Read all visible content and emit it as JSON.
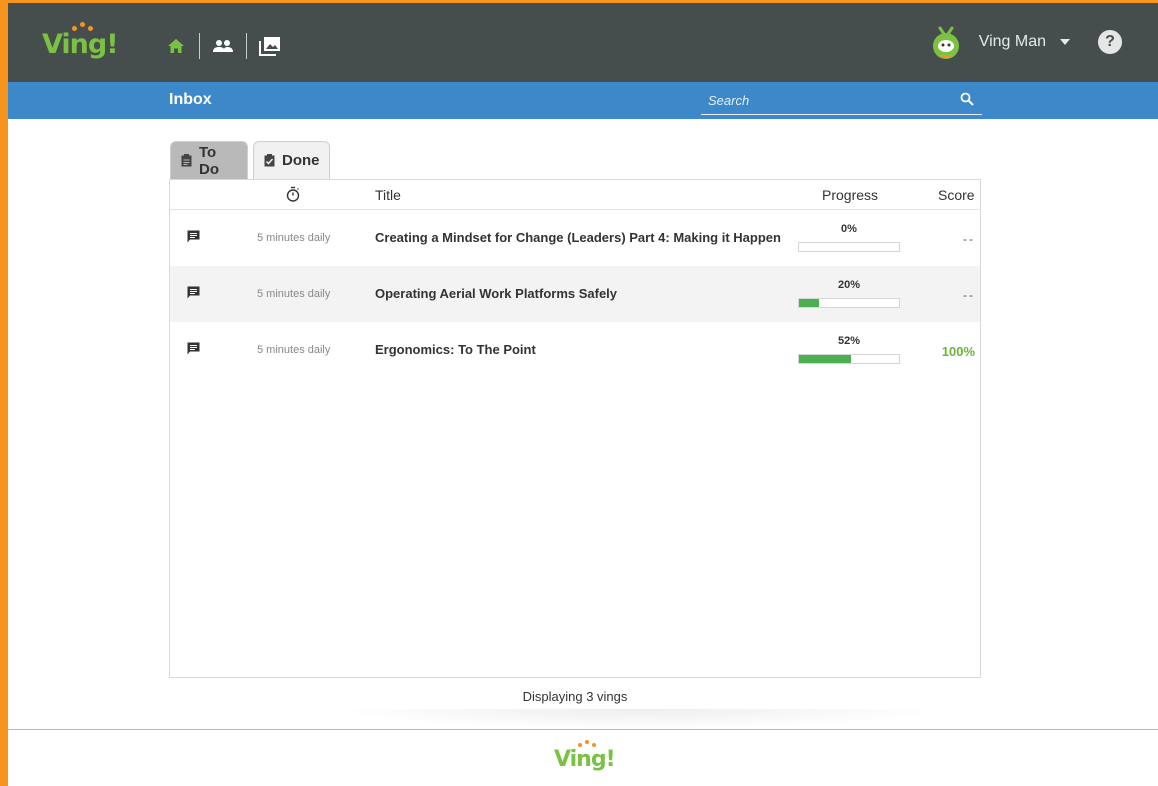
{
  "app": {
    "logo_text": "Ving!"
  },
  "header": {
    "user_name": "Ving Man",
    "help_label": "?"
  },
  "subheader": {
    "title": "Inbox",
    "search_placeholder": "Search"
  },
  "tabs": [
    {
      "label": "To Do",
      "icon": "clipboard-icon"
    },
    {
      "label": "Done",
      "icon": "clipboard-check-icon"
    }
  ],
  "table": {
    "columns": {
      "duration_icon": "stopwatch-icon",
      "title": "Title",
      "progress": "Progress",
      "score": "Score"
    },
    "rows": [
      {
        "duration": "5 minutes daily",
        "title": "Creating a Mindset for Change (Leaders) Part 4: Making it Happen",
        "progress_label": "0%",
        "progress": 0,
        "score": "--"
      },
      {
        "duration": "5 minutes daily",
        "title": "Operating Aerial Work Platforms Safely",
        "progress_label": "20%",
        "progress": 20,
        "score": "--"
      },
      {
        "duration": "5 minutes daily",
        "title": "Ergonomics: To The Point",
        "progress_label": "52%",
        "progress": 52,
        "score": "100%"
      }
    ]
  },
  "footer": {
    "count_text": "Displaying 3 vings",
    "logo_text": "Ving!"
  },
  "colors": {
    "topbar": "#454d4d",
    "subbar": "#3d88c8",
    "brand_green": "#7cc242",
    "progress_fill": "#4caf50",
    "outer_frame": "#f7941d"
  }
}
